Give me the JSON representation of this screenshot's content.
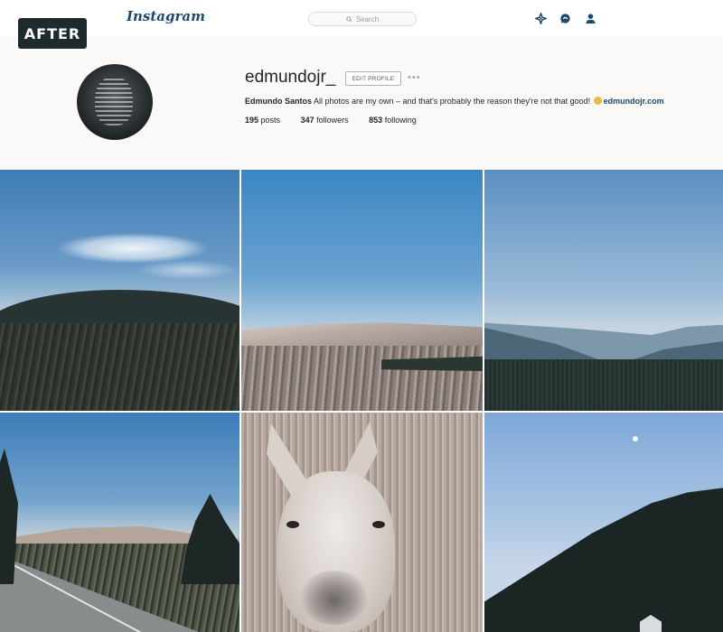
{
  "badge": {
    "label": "AFTER"
  },
  "topbar": {
    "logo": "Instagram",
    "search_placeholder": "Search",
    "icons": [
      "explore-icon",
      "activity-icon",
      "profile-icon"
    ]
  },
  "profile": {
    "username": "edmundojr_",
    "edit_profile_label": "EDIT PROFILE",
    "more_label": "•••",
    "full_name": "Edmundo Santos",
    "bio_text": " All photos are my own – and that's probably the reason they're not that good! ",
    "website": "edmundojr.com",
    "stats": [
      {
        "value": "195",
        "label": "posts"
      },
      {
        "value": "347",
        "label": "followers"
      },
      {
        "value": "853",
        "label": "following"
      }
    ]
  },
  "photos": [
    {
      "subject": "hills-with-clouds"
    },
    {
      "subject": "moorland"
    },
    {
      "subject": "valley"
    },
    {
      "subject": "road"
    },
    {
      "subject": "donkey"
    },
    {
      "subject": "dusk-forest"
    }
  ],
  "colors": {
    "brand": "#1b4a6b",
    "header_bg": "#faf9f7",
    "badge_bg": "#1f2a2e"
  }
}
